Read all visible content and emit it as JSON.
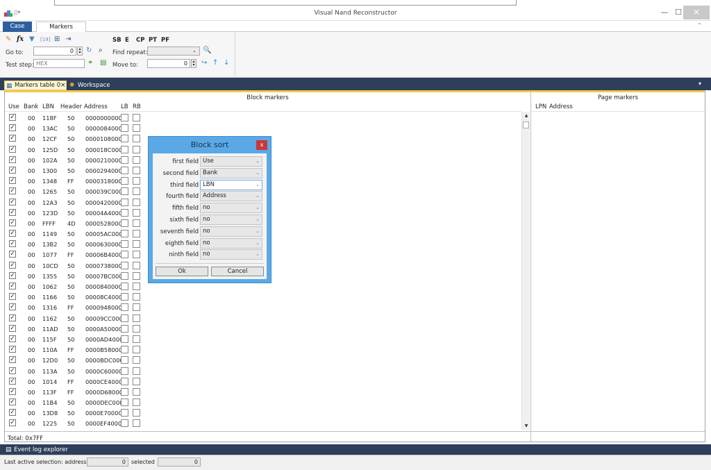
{
  "window": {
    "title": "Visual Nand Reconstructor",
    "minimize": "—",
    "maximize": "☐",
    "close": "✕"
  },
  "ribbon": {
    "tabs": [
      "Case",
      "Markers table"
    ],
    "goto_label": "Go to:",
    "goto_value": "0",
    "find_repeat_label": "Find repeat:",
    "test_step_label": "Test step:",
    "test_step_placeholder": "HEX",
    "move_to_label": "Move to:",
    "move_to_value": "0",
    "toggles": [
      "SB",
      "E",
      "CP",
      "PT",
      "PF"
    ]
  },
  "doc_tabs": [
    "Markers table 0",
    "Workspace"
  ],
  "block_markers": {
    "title": "Block markers",
    "columns": [
      "Use",
      "Bank",
      "LBN",
      "Header",
      "Address",
      "LB",
      "RB"
    ],
    "rows": [
      [
        "00",
        "118F",
        "50",
        "0000000000"
      ],
      [
        "00",
        "13AC",
        "50",
        "0000084000"
      ],
      [
        "00",
        "12CF",
        "50",
        "0000108000"
      ],
      [
        "00",
        "125D",
        "50",
        "000018C000"
      ],
      [
        "00",
        "102A",
        "50",
        "0000210000"
      ],
      [
        "00",
        "1300",
        "50",
        "0000294000"
      ],
      [
        "00",
        "1348",
        "FF",
        "0000318000"
      ],
      [
        "00",
        "1265",
        "50",
        "000039C000"
      ],
      [
        "00",
        "12A3",
        "50",
        "0000420000"
      ],
      [
        "00",
        "123D",
        "50",
        "00004A4000"
      ],
      [
        "00",
        "FFFF",
        "4D",
        "0000528000"
      ],
      [
        "00",
        "1149",
        "50",
        "00005AC000"
      ],
      [
        "00",
        "13B2",
        "50",
        "0000630000"
      ],
      [
        "00",
        "1077",
        "FF",
        "00006B4000"
      ],
      [
        "00",
        "10CD",
        "50",
        "0000738000"
      ],
      [
        "00",
        "1355",
        "50",
        "00007BC000"
      ],
      [
        "00",
        "1062",
        "50",
        "0000840000"
      ],
      [
        "00",
        "1166",
        "50",
        "00008C4000"
      ],
      [
        "00",
        "1316",
        "FF",
        "0000948000"
      ],
      [
        "00",
        "1162",
        "50",
        "00009CC000"
      ],
      [
        "00",
        "11AD",
        "50",
        "0000A50000"
      ],
      [
        "00",
        "115F",
        "50",
        "0000AD4000"
      ],
      [
        "00",
        "110A",
        "FF",
        "0000B58000"
      ],
      [
        "00",
        "12D0",
        "50",
        "0000BDC000"
      ],
      [
        "00",
        "113A",
        "50",
        "0000C60000"
      ],
      [
        "00",
        "1014",
        "FF",
        "0000CE4000"
      ],
      [
        "00",
        "113F",
        "FF",
        "0000D68000"
      ],
      [
        "00",
        "11B4",
        "50",
        "0000DEC000"
      ],
      [
        "00",
        "13D8",
        "50",
        "0000E70000"
      ],
      [
        "00",
        "1225",
        "50",
        "0000EF4000"
      ]
    ],
    "total": "Total: 0x7FF"
  },
  "page_markers": {
    "title": "Page markers",
    "columns": [
      "LPN",
      "Address"
    ]
  },
  "dialog": {
    "title": "Block sort",
    "close": "x",
    "fields": [
      {
        "label": "first field",
        "value": "Use"
      },
      {
        "label": "second field",
        "value": "Bank"
      },
      {
        "label": "third field",
        "value": "LBN"
      },
      {
        "label": "fourth field",
        "value": "Address"
      },
      {
        "label": "fifth field",
        "value": "no"
      },
      {
        "label": "sixth field",
        "value": "no"
      },
      {
        "label": "seventh field",
        "value": "no"
      },
      {
        "label": "eighth field",
        "value": "no"
      },
      {
        "label": "ninth field",
        "value": "no"
      }
    ],
    "ok_label": "Ok",
    "cancel_label": "Cancel"
  },
  "bottom": {
    "event_log_tab": "Event log explorer",
    "status_label": "Last active selection: address",
    "status_address": "0",
    "selected_label": "selected",
    "selected_value": "0"
  },
  "colors": {
    "accent_dark": "#2d3f5a",
    "case_tab": "#2f5e9e",
    "dialog_frame": "#5aa9e6",
    "dialog_close": "#c8383a",
    "doc_tab_border": "#f2c94c"
  }
}
